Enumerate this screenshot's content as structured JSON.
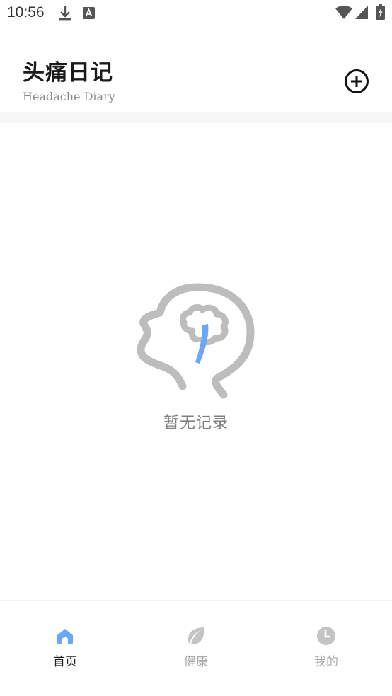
{
  "status_bar": {
    "time": "10:56",
    "icons": [
      "download-icon",
      "text-a-icon",
      "wifi-icon",
      "signal-icon",
      "battery-charging-icon"
    ]
  },
  "header": {
    "title": "头痛日记",
    "subtitle": "Headache Diary",
    "add_icon": "plus-circle-icon"
  },
  "empty_state": {
    "illustration": "head-brain-icon",
    "text": "暂无记录"
  },
  "bottom_nav": {
    "items": [
      {
        "label": "首页",
        "icon": "home-icon",
        "active": true
      },
      {
        "label": "健康",
        "icon": "leaf-icon",
        "active": false
      },
      {
        "label": "我的",
        "icon": "clock-icon",
        "active": false
      }
    ]
  },
  "colors": {
    "accent": "#6aa8f7",
    "illustration_gray": "#bdbdbd",
    "inactive": "#c4c4c4",
    "title": "#1a1a1a"
  }
}
